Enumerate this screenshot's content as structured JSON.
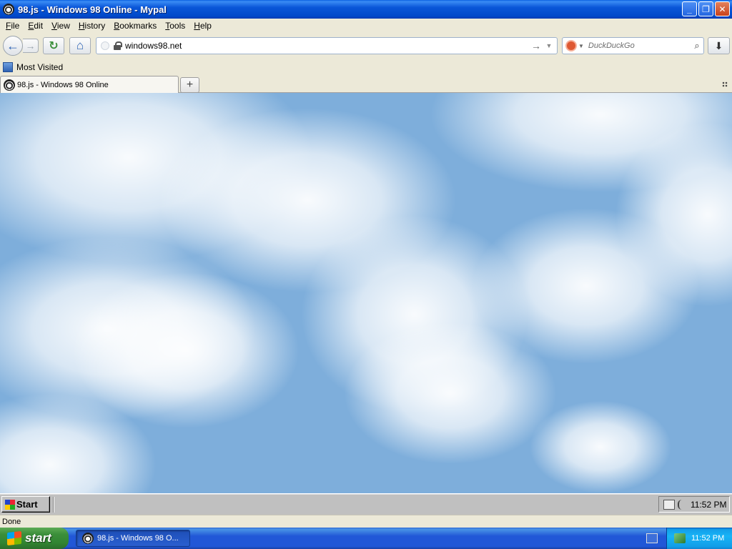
{
  "window": {
    "title": "98.js - Windows 98 Online - Mypal",
    "controls": {
      "minimize": "_",
      "restore": "❐",
      "close": "✕"
    }
  },
  "menubar": [
    "File",
    "Edit",
    "View",
    "History",
    "Bookmarks",
    "Tools",
    "Help"
  ],
  "navbar": {
    "back_icon": "←",
    "forward_icon": "→",
    "reload_icon": "↻",
    "home_icon": "⌂",
    "url": "windows98.net",
    "go_icon": "→",
    "dropdown_icon": "▼",
    "search_placeholder": "DuckDuckGo",
    "search_icon": "⌕",
    "download_icon": "⬇"
  },
  "bookmarks": {
    "most_visited": "Most Visited"
  },
  "tabs": {
    "active_label": "98.js - Windows 98 Online",
    "new_tab": "+"
  },
  "win98_taskbar": {
    "start_label": "Start",
    "clock": "11:52 PM"
  },
  "statusbar": {
    "text": "Done"
  },
  "xp_taskbar": {
    "start_label": "start",
    "task_label": "98.js - Windows 98 O...",
    "clock": "11:52 PM"
  },
  "colors": {
    "sky": "#7eaedb",
    "xp_blue": "#2157d7",
    "xp_green": "#3c8f3a",
    "win98_gray": "#c0c0c0"
  }
}
